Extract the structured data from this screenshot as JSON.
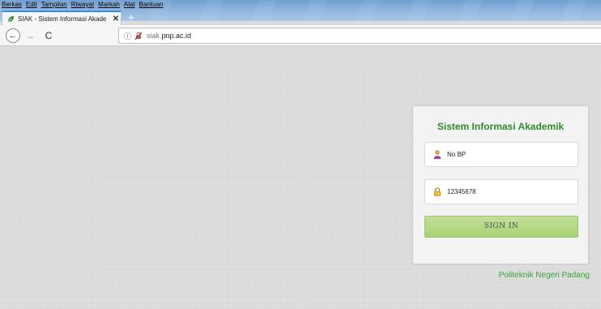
{
  "browser": {
    "menu": [
      "Berkas",
      "Edit",
      "Tampilan",
      "Riwayat",
      "Markah",
      "Alat",
      "Bantuan"
    ],
    "tab": {
      "title": "SIAK - Sistem Informasi Akade",
      "close": "✕"
    },
    "new_tab": "+",
    "nav": {
      "back": "←",
      "forward": "→",
      "reload": "C"
    },
    "url": {
      "info": "ⓘ",
      "host_prefix": "siak.",
      "host_main": "pnp.ac.id"
    }
  },
  "login": {
    "title": "Sistem Informasi Akademik",
    "username_value": "No BP",
    "password_value": "12345678",
    "signin_label": "SIGN IN"
  },
  "footer": {
    "link": "Politeknik Negeri Padang"
  },
  "colors": {
    "title_green": "#2e8b2e",
    "button_green": "#a8d276",
    "link_green": "#3aa43a"
  },
  "icons": {
    "tab_favicon": "leaf-icon",
    "username_icon": "user-icon",
    "password_icon": "lock-icon",
    "url_insecure": "insecure-lock-icon"
  }
}
